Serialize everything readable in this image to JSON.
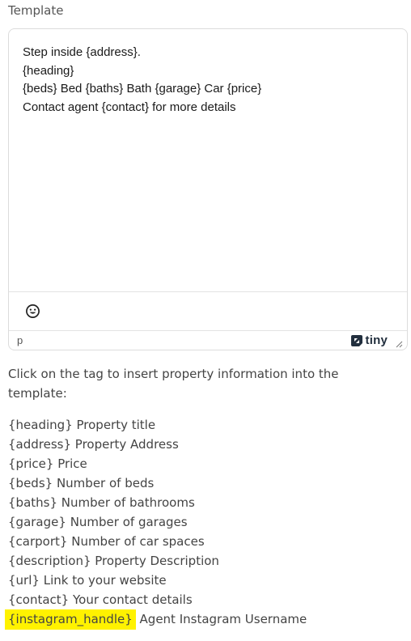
{
  "field": {
    "label": "Template"
  },
  "editor": {
    "lines": [
      "Step inside {address}.",
      "{heading}",
      "{beds} Bed {baths} Bath {garage} Car {price}",
      "Contact agent {contact} for more details"
    ],
    "toolbar": {
      "emoji_icon": "emoji-smiley-icon"
    },
    "statusbar": {
      "path": "p",
      "brand": "tiny",
      "brand_icon": "tiny-logo-icon",
      "resize_icon": "resize-handle-icon"
    }
  },
  "instructions": "Click on the tag to insert property information into the template:",
  "tags": [
    {
      "tag": "{heading}",
      "desc": " Property title"
    },
    {
      "tag": "{address}",
      "desc": " Property Address"
    },
    {
      "tag": "{price}",
      "desc": " Price"
    },
    {
      "tag": "{beds}",
      "desc": " Number of beds"
    },
    {
      "tag": "{baths}",
      "desc": " Number of bathrooms"
    },
    {
      "tag": "{garage}",
      "desc": " Number of garages"
    },
    {
      "tag": "{carport}",
      "desc": " Number of car spaces"
    },
    {
      "tag": "{description}",
      "desc": " Property Description"
    },
    {
      "tag": "{url}",
      "desc": " Link to your website"
    },
    {
      "tag": "{contact}",
      "desc": " Your contact details"
    },
    {
      "tag": "{instagram_handle}",
      "desc": " Agent Instagram Username"
    }
  ],
  "colors": {
    "highlight": "#fff200",
    "brand": "#222f3e"
  }
}
